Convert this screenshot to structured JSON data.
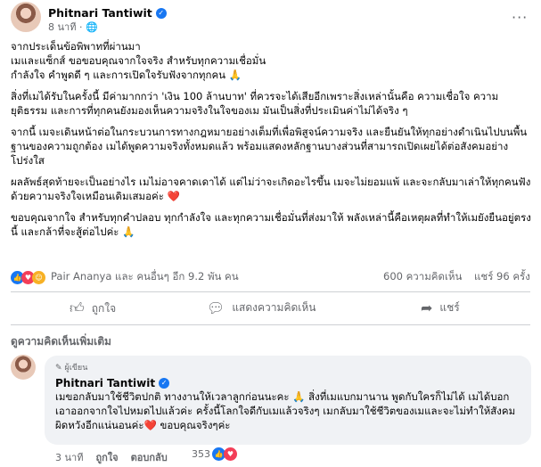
{
  "post": {
    "author": "Phitnari Tantiwit",
    "time": "8 นาที",
    "privacy_icon": "globe-icon",
    "paragraphs": [
      "จากประเด็นข้อพิพาทที่ผ่านมา\nเมและแซ็กส์ ขอขอบคุณจากใจจริง สำหรับทุกความเชื่อมั่น\n กำลังใจ คำพูดดี ๆ และการเปิดใจรับฟังจากทุกคน 🙏",
      "สิ่งที่เมได้รับในครั้งนี้ มีค่ามากกว่า 'เงิน 100 ล้านบาท' ที่ควรจะได้เสียอีกเพราะสิ่งเหล่านั้นคือ ความเชื่อใจ ความยุติธรรม และการที่ทุกคนยังมองเห็นความจริงในใจของเม มันเป็นสิ่งที่ประเมินค่าไม่ได้จริง ๆ",
      "จากนี้ เมจะเดินหน้าต่อในกระบวนการทางกฎหมายอย่างเต็มที่เพื่อพิสูจน์ความจริง และยืนยันให้ทุกอย่างดำเนินไปบนพื้นฐานของความถูกต้อง เมได้พูดความจริงทั้งหมดแล้ว พร้อมแสดงหลักฐานบางส่วนที่สามารถเปิดเผยได้ต่อสังคมอย่างโปร่งใส",
      "ผลลัพธ์สุดท้ายจะเป็นอย่างไร เมไม่อาจคาดเดาได้ แต่ไม่ว่าจะเกิดอะไรขึ้น เมจะไม่ยอมแพ้ และจะกลับมาเล่าให้ทุกคนฟังด้วยความจริงใจเหมือนเดิมเสมอค่ะ ❤️",
      "ขอบคุณจากใจ สำหรับทุกคำปลอบ ทุกกำลังใจ และทุกความเชื่อมั่นที่ส่งมาให้ พลังเหล่านี้คือเหตุผลที่ทำให้เมยังยืนอยู่ตรงนี้ และกล้าที่จะสู้ต่อไปค่ะ 🙏"
    ],
    "reactions_text": "Pair Ananya และ คนอื่นๆ อีก 9.2 พัน คน",
    "comments_count": "600 ความคิดเห็น",
    "shares_count": "แชร์ 96 ครั้ง"
  },
  "actions": {
    "like": "ถูกใจ",
    "comment": "แสดงความคิดเห็น",
    "share": "แชร์"
  },
  "comments_section": {
    "header": "ดูความคิดเห็นเพิ่มเติม",
    "comment": {
      "badge": "ผู้เขียน",
      "author": "Phitnari Tantiwit",
      "text": "เมขอกลับมาใช้ชีวิตปกติ ทางงานให้เวลาลูกก่อนนะคะ 🙏 สิ่งที่เมแบกมานาน พูดกับใครก็ไม่ได้ เมได้บอกเอาออกจากใจไปหมดไปแล้วค่ะ ครั้งนี้โลกใจดีกับเมแล้วจริงๆ เมกลับมาใช้ชีวิตของเมและจะไม่ทำให้สังคมผิดหวังอีกแน่นอนค่ะ❤️ ขอบคุณจริงๆค่ะ",
      "time": "3 นาที",
      "like": "ถูกใจ",
      "reply": "ตอบกลับ",
      "reaction_count": "353"
    }
  },
  "colors": {
    "blue": "#1877f2",
    "heart": "#f33e58",
    "muted": "#65676b"
  }
}
